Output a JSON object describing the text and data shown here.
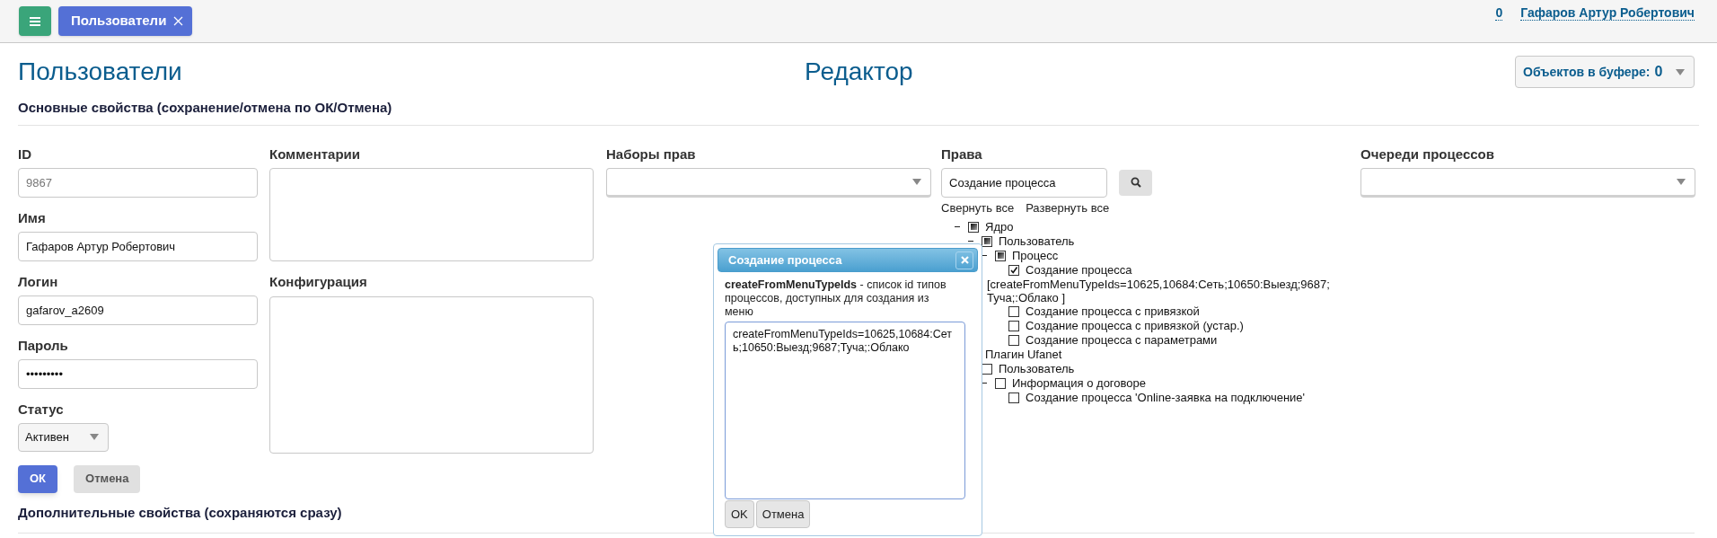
{
  "topbar": {
    "tabs": [
      {
        "label": "Пользователи",
        "selected": true
      }
    ],
    "counter": "0",
    "user": "Гафаров Артур Робертович"
  },
  "header": {
    "title": "Пользователи",
    "subtitle": "Редактор",
    "buffer": {
      "label": "Объектов в буфере:",
      "count": "0"
    }
  },
  "form": {
    "heading": "Основные свойства (сохранение/отмена по ОК/Отмена)",
    "id": {
      "label": "ID",
      "value": "9867",
      "disabled": true
    },
    "name": {
      "label": "Имя",
      "value": "Гафаров Артур Робертович"
    },
    "login": {
      "label": "Логин",
      "value": "gafarov_a2609"
    },
    "password": {
      "label": "Пароль",
      "value": "•••••••••"
    },
    "status": {
      "label": "Статус",
      "value": "Активен"
    },
    "buttons": [
      {
        "label": "ОК",
        "kind": "primary"
      },
      {
        "label": "Отмена",
        "kind": "secondary"
      }
    ],
    "comments": {
      "label": "Комментарии"
    },
    "config": {
      "label": "Конфигурация"
    },
    "permission_sets": {
      "label": "Наборы прав"
    },
    "rights": {
      "label": "Права",
      "search_value": "Создание процесса",
      "collapse_all": "Свернуть все",
      "expand_all": "Развернуть все",
      "tree": [
        {
          "label": "Ядро",
          "expanded": true,
          "checked": false,
          "partial": true,
          "children": [
            {
              "label": "Пользователь",
              "expanded": true,
              "checked": false,
              "partial": true,
              "children": [
                {
                  "label": "Процесс",
                  "expanded": true,
                  "checked": false,
                  "partial": true,
                  "children": [
                    {
                      "label": "Создание процесса",
                      "checked": true,
                      "config": "[createFromMenuTypeIds=10625,10684:Сеть;10650:Выезд;9687;Туча;:Облако ]"
                    },
                    {
                      "label": "Создание процесса с привязкой",
                      "checked": false
                    },
                    {
                      "label": "Создание процесса с привязкой (устар.)",
                      "checked": false
                    },
                    {
                      "label": "Создание процесса с параметрами",
                      "checked": false
                    }
                  ]
                }
              ]
            }
          ]
        },
        {
          "label": "Плагин Ufanet",
          "children": [
            {
              "label": "Пользователь",
              "checked": false,
              "children": [
                {
                  "label": "Информация о договоре",
                  "expanded": true,
                  "checked": false,
                  "children": [
                    {
                      "label": "Создание процесса 'Online-заявка на подключение'",
                      "checked": false
                    }
                  ]
                }
              ]
            }
          ]
        }
      ]
    },
    "queues": {
      "label": "Очереди процессов"
    },
    "extra_heading": "Дополнительные свойства (сохраняются сразу)"
  },
  "popup": {
    "title": "Создание процесса",
    "description": "**createFromMenuTypeIds** - список id типов процессов, доступных для создания из меню",
    "value": "createFromMenuTypeIds=10625,10684:Сеть;10650:Выезд;9687;Туча;:Облако",
    "buttons": [
      "OK",
      "Отмена"
    ]
  }
}
